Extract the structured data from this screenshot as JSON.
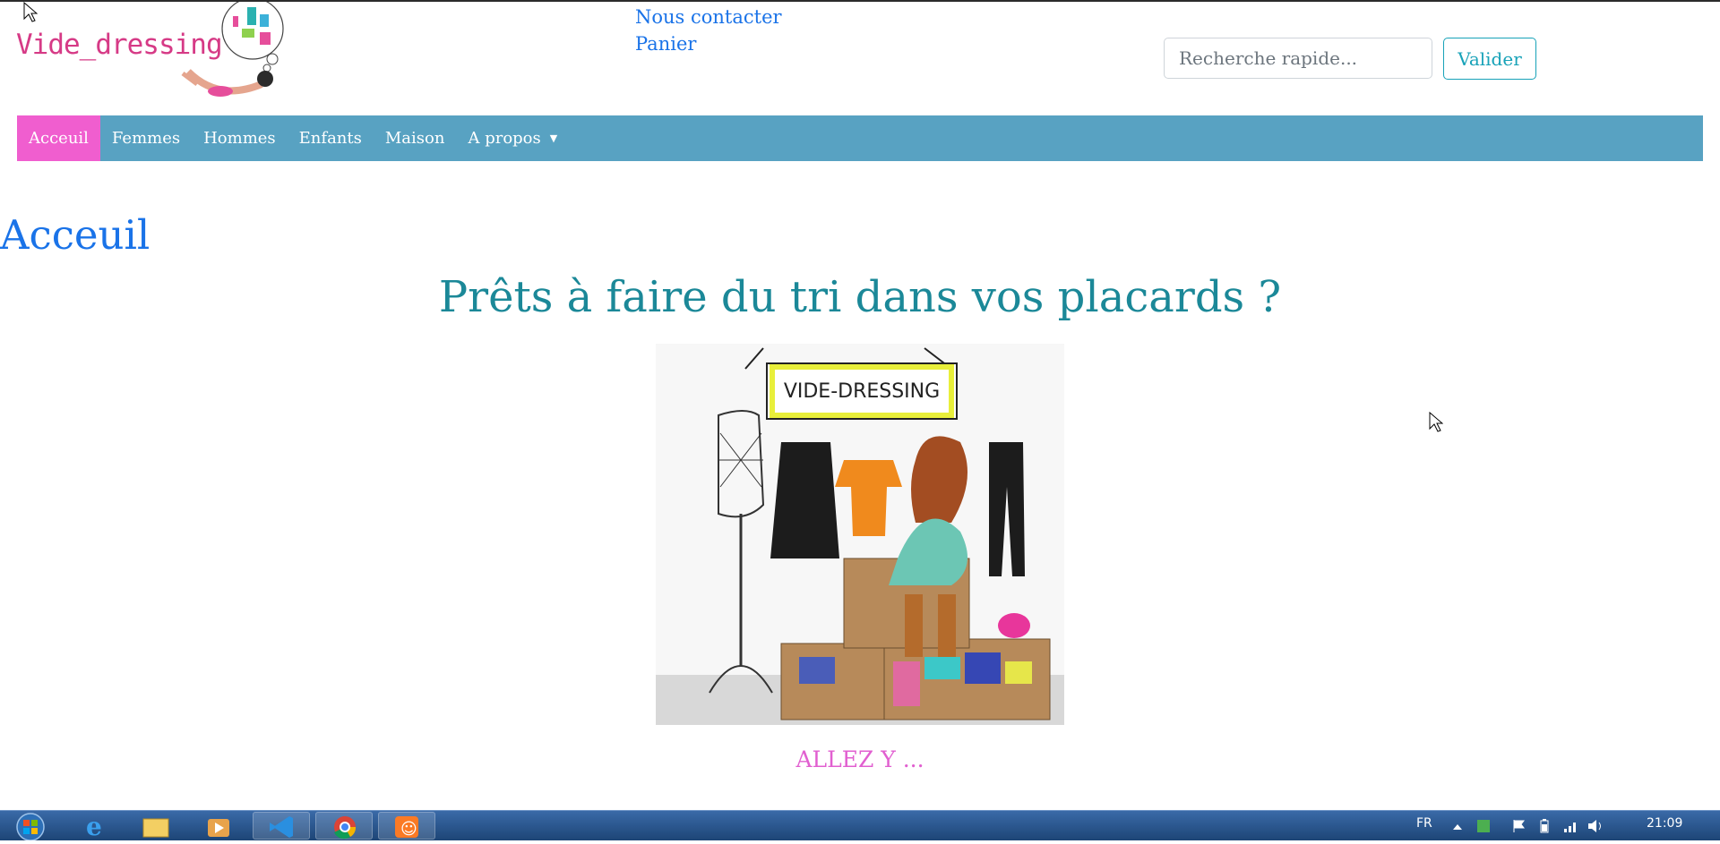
{
  "header": {
    "logo_text": "Vide_dressing",
    "links": {
      "contact": "Nous contacter",
      "cart": "Panier"
    },
    "search": {
      "placeholder": "Recherche rapide...",
      "button": "Valider"
    }
  },
  "nav": {
    "items": [
      {
        "label": "Acceuil",
        "active": true
      },
      {
        "label": "Femmes"
      },
      {
        "label": "Hommes"
      },
      {
        "label": "Enfants"
      },
      {
        "label": "Maison"
      },
      {
        "label": "A propos"
      }
    ]
  },
  "main": {
    "page_title": "Acceuil",
    "headline": "Prêts à faire du tri dans vos placards ?",
    "hero_sign": "VIDE-DRESSING",
    "cta": "ALLEZ Y ..."
  },
  "taskbar": {
    "language": "FR",
    "time": "21:09",
    "apps": [
      "start-orb",
      "internet-explorer-icon",
      "file-explorer-icon",
      "media-player-icon",
      "vscode-icon",
      "chrome-icon",
      "xampp-icon"
    ]
  },
  "colors": {
    "navbar": "#58a2c2",
    "nav_active": "#f05ecf",
    "link": "#1a73e8",
    "headline": "#1b8898",
    "cta": "#e15fd0",
    "button": "#17a2b8"
  }
}
